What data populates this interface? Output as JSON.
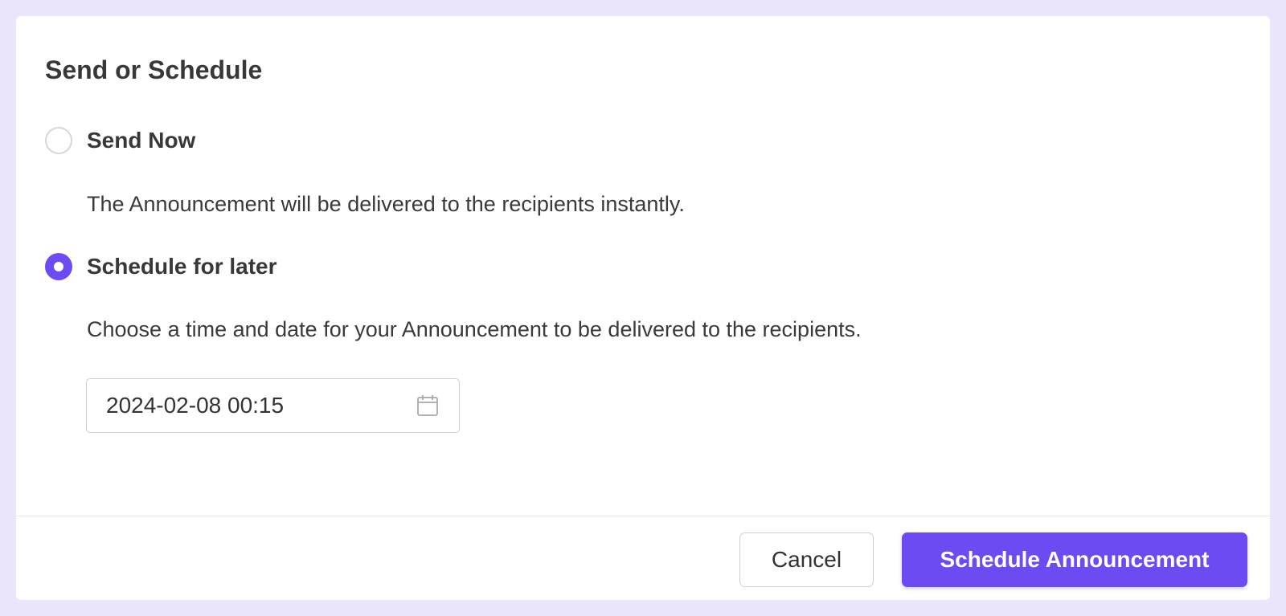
{
  "dialog": {
    "title": "Send or Schedule"
  },
  "options": {
    "send_now": {
      "label": "Send Now",
      "description": "The Announcement will be delivered to the recipients instantly.",
      "selected": false
    },
    "schedule_later": {
      "label": "Schedule for later",
      "description": "Choose a time and date for your Announcement to be delivered to the recipients.",
      "selected": true
    }
  },
  "datetime_field": {
    "value": "2024-02-08 00:15",
    "icon": "calendar-icon"
  },
  "footer": {
    "cancel_label": "Cancel",
    "submit_label": "Schedule Announcement"
  },
  "colors": {
    "accent": "#6d4bf2",
    "page_background": "#ece4fb"
  }
}
